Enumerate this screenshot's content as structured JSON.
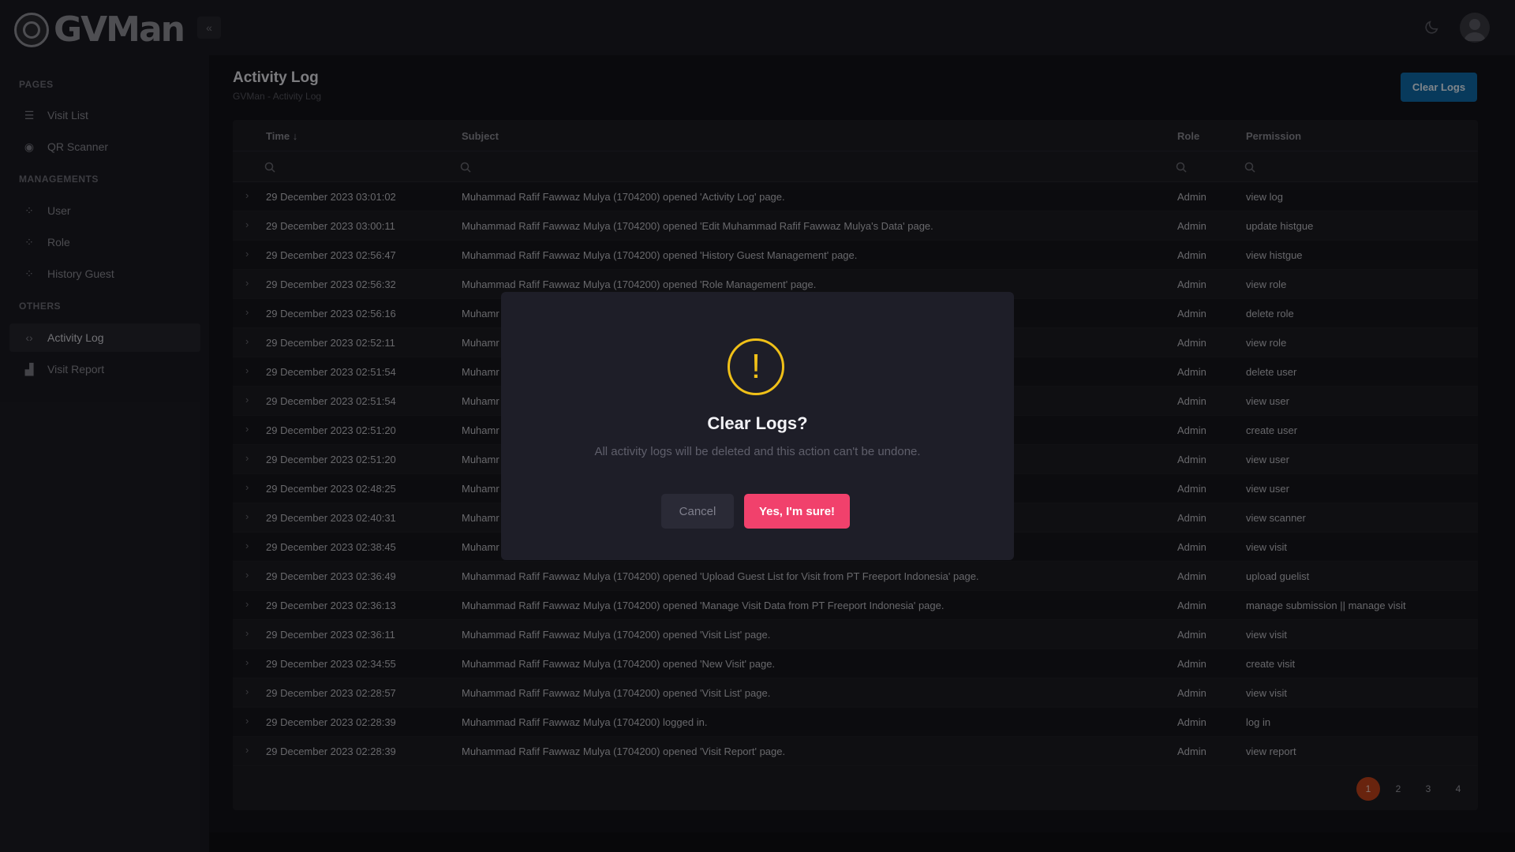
{
  "app": {
    "logo_text": "GVMan"
  },
  "sidebar": {
    "sections": [
      {
        "title": "PAGES",
        "items": [
          {
            "label": "Visit List",
            "icon": "list-icon"
          },
          {
            "label": "QR Scanner",
            "icon": "qr-scanner-icon"
          }
        ]
      },
      {
        "title": "MANAGEMENTS",
        "items": [
          {
            "label": "User",
            "icon": "grid-icon"
          },
          {
            "label": "Role",
            "icon": "grid-icon"
          },
          {
            "label": "History Guest",
            "icon": "grid-icon"
          }
        ]
      },
      {
        "title": "OTHERS",
        "items": [
          {
            "label": "Activity Log",
            "icon": "code-icon",
            "active": true
          },
          {
            "label": "Visit Report",
            "icon": "chart-icon"
          }
        ]
      }
    ]
  },
  "header": {
    "title": "Activity Log",
    "breadcrumb": [
      "GVMan",
      "Activity Log"
    ],
    "clear_button": "Clear Logs"
  },
  "table": {
    "columns": {
      "time": "Time",
      "subject": "Subject",
      "role": "Role",
      "permission": "Permission"
    },
    "sort_indicator": "↓",
    "rows": [
      {
        "time": "29 December 2023 03:01:02",
        "subject": "Muhammad Rafif Fawwaz Mulya (1704200) opened 'Activity Log' page.",
        "role": "Admin",
        "permission": "view log"
      },
      {
        "time": "29 December 2023 03:00:11",
        "subject": "Muhammad Rafif Fawwaz Mulya (1704200) opened 'Edit Muhammad Rafif Fawwaz Mulya's Data' page.",
        "role": "Admin",
        "permission": "update histgue"
      },
      {
        "time": "29 December 2023 02:56:47",
        "subject": "Muhammad Rafif Fawwaz Mulya (1704200) opened 'History Guest Management' page.",
        "role": "Admin",
        "permission": "view histgue"
      },
      {
        "time": "29 December 2023 02:56:32",
        "subject": "Muhammad Rafif Fawwaz Mulya (1704200) opened 'Role Management' page.",
        "role": "Admin",
        "permission": "view role"
      },
      {
        "time": "29 December 2023 02:56:16",
        "subject": "Muhamr",
        "role": "Admin",
        "permission": "delete role"
      },
      {
        "time": "29 December 2023 02:52:11",
        "subject": "Muhamr",
        "role": "Admin",
        "permission": "view role"
      },
      {
        "time": "29 December 2023 02:51:54",
        "subject": "Muhamr",
        "role": "Admin",
        "permission": "delete user"
      },
      {
        "time": "29 December 2023 02:51:54",
        "subject": "Muhamr",
        "role": "Admin",
        "permission": "view user"
      },
      {
        "time": "29 December 2023 02:51:20",
        "subject": "Muhamr",
        "role": "Admin",
        "permission": "create user"
      },
      {
        "time": "29 December 2023 02:51:20",
        "subject": "Muhamr",
        "role": "Admin",
        "permission": "view user"
      },
      {
        "time": "29 December 2023 02:48:25",
        "subject": "Muhamr",
        "role": "Admin",
        "permission": "view user"
      },
      {
        "time": "29 December 2023 02:40:31",
        "subject": "Muhamr",
        "role": "Admin",
        "permission": "view scanner"
      },
      {
        "time": "29 December 2023 02:38:45",
        "subject": "Muhamr",
        "role": "Admin",
        "permission": "view visit"
      },
      {
        "time": "29 December 2023 02:36:49",
        "subject": "Muhammad Rafif Fawwaz Mulya (1704200) opened 'Upload Guest List for Visit from PT Freeport Indonesia' page.",
        "role": "Admin",
        "permission": "upload guelist"
      },
      {
        "time": "29 December 2023 02:36:13",
        "subject": "Muhammad Rafif Fawwaz Mulya (1704200) opened 'Manage Visit Data from PT Freeport Indonesia' page.",
        "role": "Admin",
        "permission": "manage submission || manage visit"
      },
      {
        "time": "29 December 2023 02:36:11",
        "subject": "Muhammad Rafif Fawwaz Mulya (1704200) opened 'Visit List' page.",
        "role": "Admin",
        "permission": "view visit"
      },
      {
        "time": "29 December 2023 02:34:55",
        "subject": "Muhammad Rafif Fawwaz Mulya (1704200) opened 'New Visit' page.",
        "role": "Admin",
        "permission": "create visit"
      },
      {
        "time": "29 December 2023 02:28:57",
        "subject": "Muhammad Rafif Fawwaz Mulya (1704200) opened 'Visit List' page.",
        "role": "Admin",
        "permission": "view visit"
      },
      {
        "time": "29 December 2023 02:28:39",
        "subject": "Muhammad Rafif Fawwaz Mulya (1704200) logged in.",
        "role": "Admin",
        "permission": "log in"
      },
      {
        "time": "29 December 2023 02:28:39",
        "subject": "Muhammad Rafif Fawwaz Mulya (1704200) opened 'Visit Report' page.",
        "role": "Admin",
        "permission": "view report"
      }
    ]
  },
  "pagination": {
    "pages": [
      "1",
      "2",
      "3",
      "4"
    ],
    "current": "1"
  },
  "modal": {
    "icon": "!",
    "title": "Clear Logs?",
    "message": "All activity logs will be deleted and this action can't be undone.",
    "cancel_label": "Cancel",
    "confirm_label": "Yes, I'm sure!"
  },
  "colors": {
    "accent": "#0f6aa8",
    "confirm": "#f1416c",
    "warning": "#f0c018",
    "page_active": "#c0431b"
  }
}
